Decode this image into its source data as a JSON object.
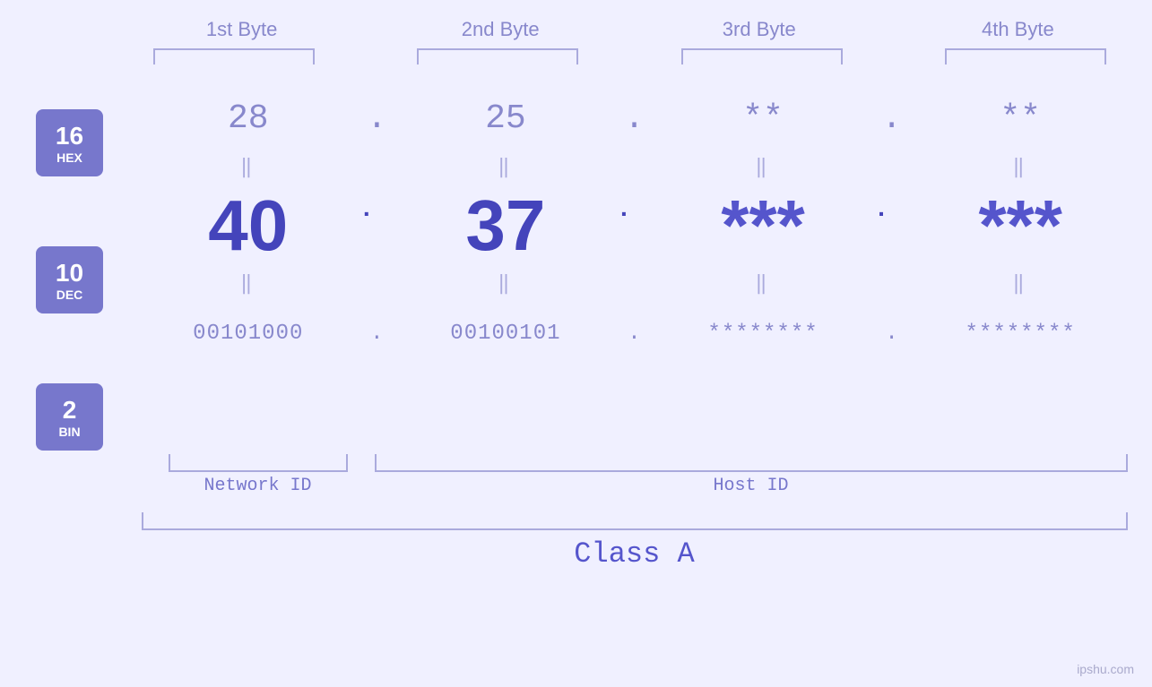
{
  "headers": {
    "byte1": "1st Byte",
    "byte2": "2nd Byte",
    "byte3": "3rd Byte",
    "byte4": "4th Byte"
  },
  "bases": {
    "hex": {
      "number": "16",
      "label": "HEX"
    },
    "dec": {
      "number": "10",
      "label": "DEC"
    },
    "bin": {
      "number": "2",
      "label": "BIN"
    }
  },
  "rows": {
    "hex": {
      "b1": "28",
      "d1": ".",
      "b2": "25",
      "d2": ".",
      "b3": "**",
      "d3": ".",
      "b4": "**"
    },
    "dec": {
      "b1": "40",
      "d1": ".",
      "b2": "37",
      "d2": ".",
      "b3": "***",
      "d3": ".",
      "b4": "***"
    },
    "bin": {
      "b1": "00101000",
      "d1": ".",
      "b2": "00100101",
      "d2": ".",
      "b3": "********",
      "d3": ".",
      "b4": "********"
    }
  },
  "labels": {
    "network_id": "Network ID",
    "host_id": "Host ID",
    "class": "Class A"
  },
  "watermark": "ipshu.com"
}
